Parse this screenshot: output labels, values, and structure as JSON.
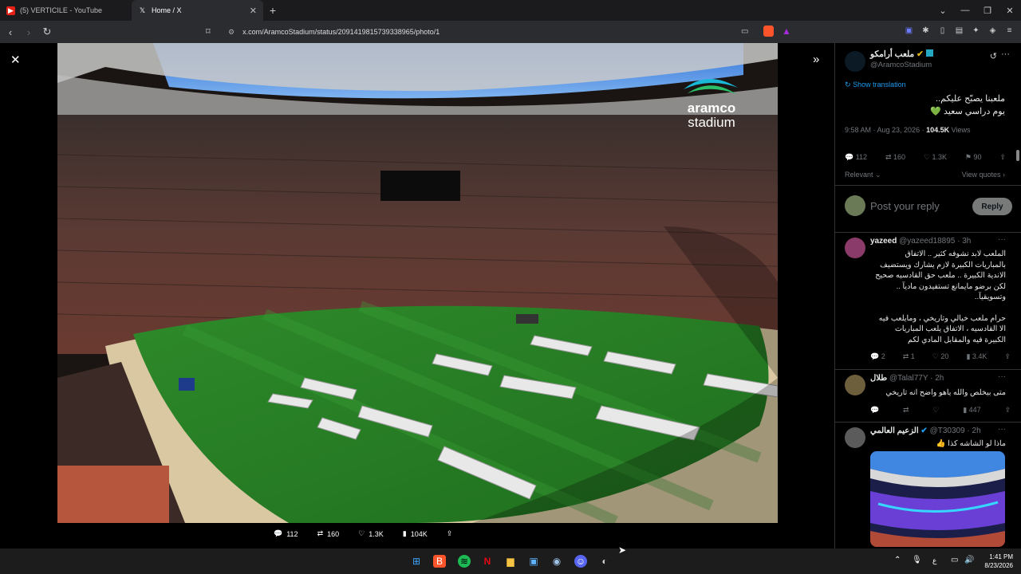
{
  "browser": {
    "tabs": [
      {
        "title": "(5) VERTICILE - YouTube",
        "active": false,
        "icon": "youtube-icon"
      },
      {
        "title": "Home / X",
        "active": true,
        "icon": "x-logo-icon"
      }
    ],
    "url": "x.com/AramcoStadium/status/2091419815739338965/photo/1"
  },
  "photo": {
    "logo_line1": "aramco",
    "logo_line2": "stadium",
    "actions": {
      "replies": "112",
      "reposts": "160",
      "likes": "1.3K",
      "views": "104K"
    }
  },
  "tweet": {
    "display_name": "ملعب أرامكو",
    "handle": "@AramcoStadium",
    "show_translation": "Show translation",
    "text_line1": "ملعبنا يصبّح عليكم..",
    "text_line2": "يوم دراسي سعيد 💚",
    "time": "9:58 AM · Aug 23, 2026 · ",
    "views_count": "104.5K",
    "views_label": " Views",
    "stats": {
      "replies": "112",
      "reposts": "160",
      "likes": "1.3K",
      "bookmarks": "90"
    },
    "relevant": "Relevant",
    "view_quotes": "View quotes"
  },
  "reply_box": {
    "placeholder": "Post your reply",
    "button": "Reply"
  },
  "replies": [
    {
      "name": "yazeed",
      "handle": "@yazeed18895 · 3h",
      "text": [
        "الملعب لابد نشوفه كثير .. الاتفاق",
        "بالمباريات الكبيرة لازم يشارك ويستضيف",
        "الاندية الكبيرة .. ملعب حق القادسيه صحيح",
        "لكن برضو مايمانع تستفيدون ماديآ ..",
        "وتسويقيآ..",
        "",
        "حرام ملعب خيالي وتاريخي ، ومايلعب فيه",
        "الا القادسيه ، الاتفاق يلعب المباريات",
        "الكبيرة فيه والمقابل المادي لكم"
      ],
      "replies": "2",
      "reposts": "1",
      "likes": "20",
      "views": "3.4K"
    },
    {
      "name": "طلال",
      "handle": "@Talal77Y · 2h",
      "text": [
        "متى بيخلص والله ياهو واضح انه تاريخي"
      ],
      "replies": "",
      "reposts": "",
      "likes": "",
      "views": "447"
    },
    {
      "name": "الزعيم العالمي",
      "handle": "@T30309 · 2h",
      "text": [
        "ماذا لو الشاشه كذا 👍"
      ]
    }
  ],
  "taskbar": {
    "time": "1:41 PM",
    "date": "8/23/2026",
    "lang": "ع"
  }
}
